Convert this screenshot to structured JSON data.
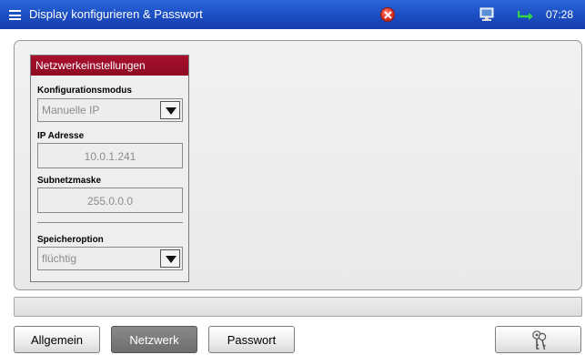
{
  "titlebar": {
    "title": "Display konfigurieren & Passwort",
    "clock": "07:28",
    "icons": [
      "menu-icon",
      "error-icon",
      "monitor-icon",
      "usb-icon"
    ]
  },
  "network": {
    "header": "Netzwerkeinstellungen",
    "config_mode_label": "Konfigurationsmodus",
    "config_mode_value": "Manuelle IP",
    "ip_label": "IP Adresse",
    "ip_value": "10.0.1.241",
    "subnet_label": "Subnetzmaske",
    "subnet_value": "255.0.0.0",
    "storage_label": "Speicheroption",
    "storage_value": "flüchtig"
  },
  "tabs": [
    {
      "label": "Allgemein",
      "active": false
    },
    {
      "label": "Netzwerk",
      "active": true
    },
    {
      "label": "Passwort",
      "active": false
    }
  ],
  "tools": {
    "key_icon": "keys-icon"
  },
  "colors": {
    "titlebar": "#1c4fc4",
    "section_header": "#9a0d28",
    "active_tab": "#7a7a7a"
  }
}
